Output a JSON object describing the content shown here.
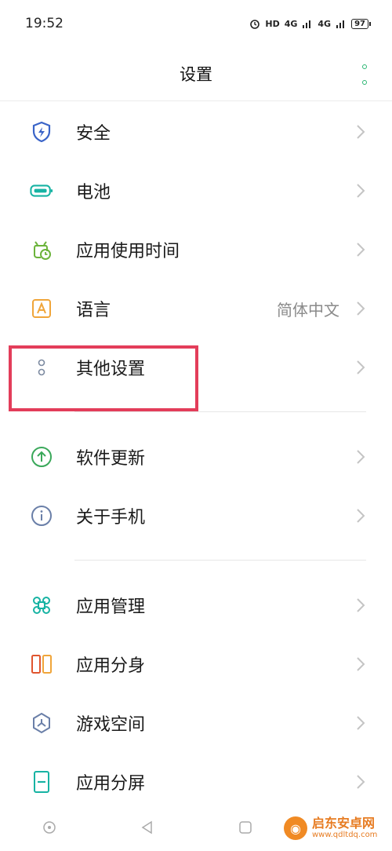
{
  "status_bar": {
    "time": "19:52",
    "indicators": [
      "HD",
      "4G",
      "4G"
    ],
    "battery": "97"
  },
  "header": {
    "title": "设置"
  },
  "items": [
    {
      "label": "安全",
      "value": "",
      "icon": "shield-bolt-icon"
    },
    {
      "label": "电池",
      "value": "",
      "icon": "battery-icon"
    },
    {
      "label": "应用使用时间",
      "value": "",
      "icon": "clock-alarm-icon"
    },
    {
      "label": "语言",
      "value": "简体中文",
      "icon": "language-a-icon"
    },
    {
      "label": "其他设置",
      "value": "",
      "icon": "dots-vertical-icon"
    },
    {
      "label": "软件更新",
      "value": "",
      "icon": "upload-arrow-icon"
    },
    {
      "label": "关于手机",
      "value": "",
      "icon": "info-icon"
    },
    {
      "label": "应用管理",
      "value": "",
      "icon": "command-icon"
    },
    {
      "label": "应用分身",
      "value": "",
      "icon": "split-app-icon"
    },
    {
      "label": "游戏空间",
      "value": "",
      "icon": "game-space-icon"
    },
    {
      "label": "应用分屏",
      "value": "",
      "icon": "split-screen-icon"
    }
  ],
  "watermark": {
    "title": "启东安卓网",
    "url": "www.qdltdq.com"
  },
  "colors": {
    "accent": "#2bb673",
    "highlight": "#e33d5a"
  }
}
